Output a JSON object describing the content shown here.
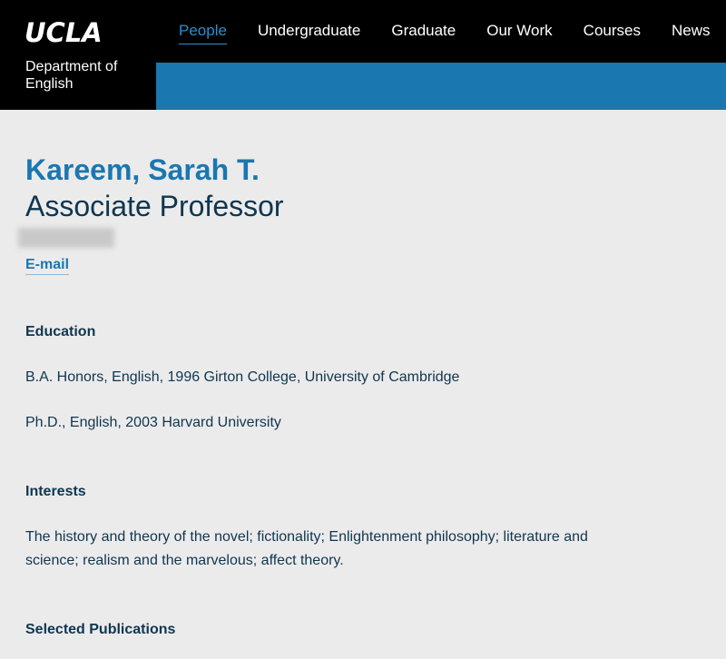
{
  "header": {
    "logo": "UCLA",
    "department": "Department of English",
    "nav": [
      {
        "label": "People",
        "active": true
      },
      {
        "label": "Undergraduate",
        "active": false
      },
      {
        "label": "Graduate",
        "active": false
      },
      {
        "label": "Our Work",
        "active": false
      },
      {
        "label": "Courses",
        "active": false
      },
      {
        "label": "News",
        "active": false
      }
    ]
  },
  "profile": {
    "name": "Kareem, Sarah T.",
    "title": "Associate Professor",
    "email_label": "E-mail"
  },
  "education": {
    "heading": "Education",
    "items": [
      "B.A. Honors, English, 1996 Girton College, University of Cambridge",
      "Ph.D., English, 2003 Harvard University"
    ]
  },
  "interests": {
    "heading": "Interests",
    "text": "The history and theory of the novel; fictionality; Enlightenment philosophy; literature and science; realism and the marvelous; affect theory."
  },
  "publications": {
    "heading": "Selected Publications"
  },
  "colors": {
    "accent": "#1a77b0",
    "text": "#0e3650",
    "background": "#ecebeb",
    "header": "#000000"
  }
}
